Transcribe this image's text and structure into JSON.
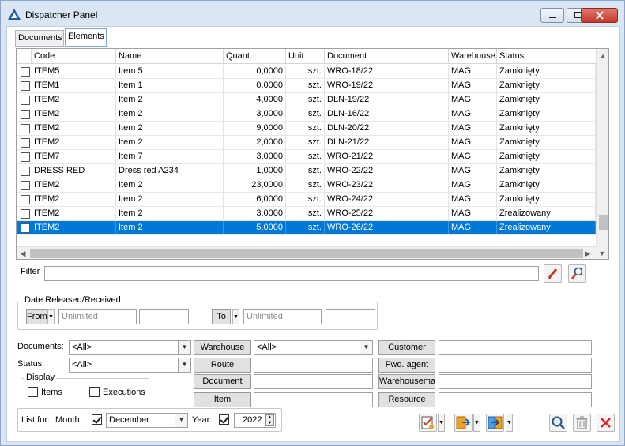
{
  "window": {
    "title": "Dispatcher Panel"
  },
  "tabs": [
    {
      "label": "Documents"
    },
    {
      "label": "Elements"
    }
  ],
  "grid": {
    "columns": [
      "Code",
      "Name",
      "Quant.",
      "Unit",
      "Document",
      "Warehouse",
      "Status"
    ],
    "rows": [
      {
        "code": "ITEM5",
        "name": "Item 5",
        "quant": "0,0000",
        "unit": "szt.",
        "document": "WRO-18/22",
        "warehouse": "MAG",
        "status": "Zamknięty"
      },
      {
        "code": "ITEM1",
        "name": "Item 1",
        "quant": "0,0000",
        "unit": "szt.",
        "document": "WRO-19/22",
        "warehouse": "MAG",
        "status": "Zamknięty"
      },
      {
        "code": "ITEM2",
        "name": "Item 2",
        "quant": "4,0000",
        "unit": "szt.",
        "document": "DLN-19/22",
        "warehouse": "MAG",
        "status": "Zamknięty"
      },
      {
        "code": "ITEM2",
        "name": "Item 2",
        "quant": "3,0000",
        "unit": "szt.",
        "document": "DLN-16/22",
        "warehouse": "MAG",
        "status": "Zamknięty"
      },
      {
        "code": "ITEM2",
        "name": "Item 2",
        "quant": "9,0000",
        "unit": "szt.",
        "document": "DLN-20/22",
        "warehouse": "MAG",
        "status": "Zamknięty"
      },
      {
        "code": "ITEM2",
        "name": "Item 2",
        "quant": "2,0000",
        "unit": "szt.",
        "document": "DLN-21/22",
        "warehouse": "MAG",
        "status": "Zamknięty"
      },
      {
        "code": "ITEM7",
        "name": "Item 7",
        "quant": "3,0000",
        "unit": "szt.",
        "document": "WRO-21/22",
        "warehouse": "MAG",
        "status": "Zamknięty"
      },
      {
        "code": "DRESS RED",
        "name": "Dress red A234",
        "quant": "1,0000",
        "unit": "szt.",
        "document": "WRO-22/22",
        "warehouse": "MAG",
        "status": "Zamknięty"
      },
      {
        "code": "ITEM2",
        "name": "Item 2",
        "quant": "23,0000",
        "unit": "szt.",
        "document": "WRO-23/22",
        "warehouse": "MAG",
        "status": "Zamknięty"
      },
      {
        "code": "ITEM2",
        "name": "Item 2",
        "quant": "6,0000",
        "unit": "szt.",
        "document": "WRO-24/22",
        "warehouse": "MAG",
        "status": "Zamknięty"
      },
      {
        "code": "ITEM2",
        "name": "Item 2",
        "quant": "3,0000",
        "unit": "szt.",
        "document": "WRO-25/22",
        "warehouse": "MAG",
        "status": "Zrealizowany"
      },
      {
        "code": "ITEM2",
        "name": "Item 2",
        "quant": "5,0000",
        "unit": "szt.",
        "document": "WRO-26/22",
        "warehouse": "MAG",
        "status": "Zrealizowany"
      }
    ]
  },
  "filter": {
    "label": "Filter",
    "value": ""
  },
  "date_group": {
    "title": "Date Released/Received",
    "from_label": "From",
    "from_value": "Unlimited",
    "to_label": "To",
    "to_value": "Unlimited"
  },
  "criteria": {
    "documents_label": "Documents:",
    "documents_value": "<All>",
    "status_label": "Status:",
    "status_value": "<All>",
    "warehouse_button": "Warehouse",
    "warehouse_value": "<All>",
    "route_button": "Route",
    "document_button": "Document",
    "item_button": "Item",
    "customer_button": "Customer",
    "fwd_agent_button": "Fwd. agent",
    "warehouseman_button": "Warehouseman",
    "resource_button": "Resource"
  },
  "display": {
    "title": "Display",
    "items_label": "Items",
    "executions_label": "Executions"
  },
  "list_for": {
    "label": "List for:",
    "month_label": "Month",
    "month_value": "December",
    "year_label": "Year:",
    "year_value": "2022"
  },
  "icons": {
    "app": "dispatcher-icon",
    "search": "search-icon",
    "delete": "trash-icon",
    "close": "close-icon"
  }
}
